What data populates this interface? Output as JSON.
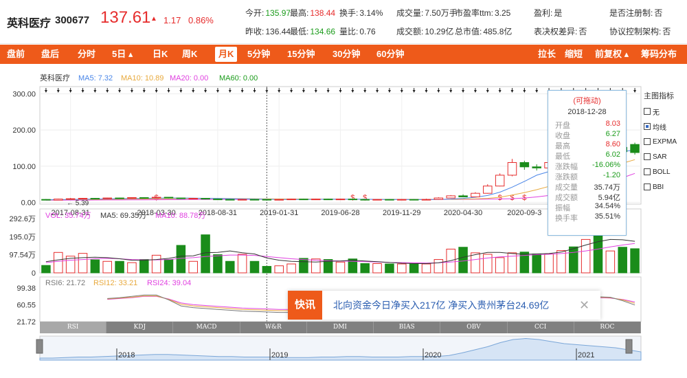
{
  "stock": {
    "name": "英科医疗",
    "code": "300677",
    "price": "137.61",
    "arrow": "▲",
    "change": "1.17",
    "change_pct": "0.86%"
  },
  "quote": [
    {
      "label": "今开:",
      "value": "135.97",
      "cls": "down"
    },
    {
      "label": "最高:",
      "value": "138.44",
      "cls": "up"
    },
    {
      "label": "换手:",
      "value": "3.14%",
      "cls": ""
    },
    {
      "label": "成交量:",
      "value": "7.50万手",
      "cls": ""
    },
    {
      "label": "市盈率ttm:",
      "value": "3.25",
      "cls": ""
    },
    {
      "label": "盈利:",
      "value": "是",
      "cls": ""
    },
    {
      "label": "是否注册制:",
      "value": "否",
      "cls": ""
    },
    {
      "label": "昨收:",
      "value": "136.44",
      "cls": ""
    },
    {
      "label": "最低:",
      "value": "134.66",
      "cls": "down"
    },
    {
      "label": "量比:",
      "value": "0.76",
      "cls": ""
    },
    {
      "label": "成交额:",
      "value": "10.29亿",
      "cls": ""
    },
    {
      "label": "总市值:",
      "value": "485.8亿",
      "cls": ""
    },
    {
      "label": "表决权差异:",
      "value": "否",
      "cls": ""
    },
    {
      "label": "协议控制架构:",
      "value": "否",
      "cls": ""
    }
  ],
  "toolbar": {
    "left": [
      "盘前",
      "盘后",
      "分时",
      "5日 ▴",
      "日K",
      "周K",
      "月K",
      "5分钟",
      "15分钟",
      "30分钟",
      "60分钟"
    ],
    "active": "月K",
    "right": [
      "拉长",
      "缩短",
      "前复权 ▴",
      "筹码分布"
    ]
  },
  "ma_legend": {
    "name": "英科医疗",
    "items": [
      {
        "label": "MA5: 7.32",
        "color": "#4a86e8"
      },
      {
        "label": "MA10: 10.89",
        "color": "#e8a93c"
      },
      {
        "label": "MA20: 0.00",
        "color": "#e040e0"
      },
      {
        "label": "MA60: 0.00",
        "color": "#1a9b1a"
      }
    ]
  },
  "vol_legend": [
    {
      "label": "VOL: 35.74万",
      "color": "#e040e0"
    },
    {
      "label": "MA5: 69.35万",
      "color": "#333333"
    },
    {
      "label": "MA10: 88.78万",
      "color": "#e040e0"
    }
  ],
  "rsi_legend": [
    {
      "label": "RSI6: 21.72",
      "color": "#777777"
    },
    {
      "label": "RSI12: 33.21",
      "color": "#e8a93c"
    },
    {
      "label": "RSI24: 39.04",
      "color": "#e040e0"
    }
  ],
  "low_marker": "5.39",
  "side_panel": {
    "title": "主图指标",
    "items": [
      {
        "label": "无",
        "checked": false
      },
      {
        "label": "均线",
        "checked": true
      },
      {
        "label": "EXPMA",
        "checked": false
      },
      {
        "label": "SAR",
        "checked": false
      },
      {
        "label": "BOLL",
        "checked": false
      },
      {
        "label": "BBI",
        "checked": false
      }
    ]
  },
  "tooltip": {
    "title": "(可拖动)",
    "date": "2018-12-28",
    "rows": [
      {
        "k": "开盘",
        "v": "8.03",
        "cls": "up"
      },
      {
        "k": "收盘",
        "v": "6.27",
        "cls": "down"
      },
      {
        "k": "最高",
        "v": "8.60",
        "cls": "up"
      },
      {
        "k": "最低",
        "v": "6.02",
        "cls": "down"
      },
      {
        "k": "涨跌幅",
        "v": "-16.06%",
        "cls": "down"
      },
      {
        "k": "涨跌额",
        "v": "-1.20",
        "cls": "down"
      },
      {
        "k": "成交量",
        "v": "35.74万",
        "cls": ""
      },
      {
        "k": "成交额",
        "v": "5.94亿",
        "cls": ""
      },
      {
        "k": "振幅",
        "v": "34.54%",
        "cls": ""
      },
      {
        "k": "换手率",
        "v": "35.51%",
        "cls": ""
      }
    ]
  },
  "news": {
    "badge": "快讯",
    "text": "北向资金今日净买入217亿 净买入贵州茅台24.69亿",
    "close": "✕"
  },
  "indicator_tabs": [
    "RSI",
    "KDJ",
    "MACD",
    "W&R",
    "DMI",
    "BIAS",
    "OBV",
    "CCI",
    "ROC"
  ],
  "indicator_active": "RSI",
  "navigator_years": [
    "2018",
    "2019",
    "2020",
    "2021"
  ],
  "chart_data": {
    "type": "candlestick",
    "price_axis": [
      "300.00",
      "200.00",
      "100.00",
      "0.00"
    ],
    "price_ticks": [
      300,
      200,
      100,
      0
    ],
    "price_range": [
      -5,
      320
    ],
    "date_labels": [
      "2017-08-31",
      "2018-03-30",
      "2018-08-31",
      "2019-01-31",
      "2019-06-28",
      "2019-11-29",
      "2020-04-30",
      "2020-09-3"
    ],
    "date_positions": [
      2,
      9,
      14,
      19,
      24,
      29,
      34,
      39
    ],
    "vol_axis": [
      "292.6万",
      "195.0万",
      "97.54万",
      "0"
    ],
    "vol_ticks": [
      292.6,
      195.0,
      97.54,
      0
    ],
    "vol_max": 300,
    "rsi_axis": [
      "99.38",
      "60.55",
      "21.72"
    ],
    "rsi_ticks": [
      99.38,
      60.55,
      21.72
    ],
    "rsi_range": [
      21.72,
      99.38
    ],
    "candles": [
      {
        "o": 8,
        "c": 6,
        "h": 9,
        "l": 5.4
      },
      {
        "o": 6,
        "c": 9,
        "h": 10,
        "l": 5.5
      },
      {
        "o": 9,
        "c": 10,
        "h": 12,
        "l": 8
      },
      {
        "o": 10,
        "c": 11,
        "h": 12,
        "l": 9
      },
      {
        "o": 11,
        "c": 10,
        "h": 12,
        "l": 9
      },
      {
        "o": 10,
        "c": 12,
        "h": 13,
        "l": 9
      },
      {
        "o": 12,
        "c": 11,
        "h": 13,
        "l": 10
      },
      {
        "o": 11,
        "c": 13,
        "h": 14,
        "l": 10
      },
      {
        "o": 13,
        "c": 12,
        "h": 14,
        "l": 11
      },
      {
        "o": 12,
        "c": 14,
        "h": 15,
        "l": 11
      },
      {
        "o": 14,
        "c": 12,
        "h": 15,
        "l": 11
      },
      {
        "o": 12,
        "c": 10,
        "h": 13,
        "l": 9
      },
      {
        "o": 10,
        "c": 11,
        "h": 12,
        "l": 9
      },
      {
        "o": 11,
        "c": 9,
        "h": 12,
        "l": 8
      },
      {
        "o": 9,
        "c": 8,
        "h": 10,
        "l": 7
      },
      {
        "o": 8,
        "c": 7,
        "h": 9,
        "l": 6
      },
      {
        "o": 7,
        "c": 8,
        "h": 9,
        "l": 6
      },
      {
        "o": 8,
        "c": 7,
        "h": 9,
        "l": 6
      },
      {
        "o": 8.03,
        "c": 6.27,
        "h": 8.6,
        "l": 6.02
      },
      {
        "o": 6,
        "c": 8,
        "h": 9,
        "l": 5.8
      },
      {
        "o": 8,
        "c": 9,
        "h": 10,
        "l": 7
      },
      {
        "o": 9,
        "c": 8,
        "h": 10,
        "l": 7
      },
      {
        "o": 8,
        "c": 9,
        "h": 10,
        "l": 7
      },
      {
        "o": 9,
        "c": 8,
        "h": 10,
        "l": 7
      },
      {
        "o": 8,
        "c": 9,
        "h": 10,
        "l": 7
      },
      {
        "o": 9,
        "c": 8,
        "h": 10,
        "l": 7
      },
      {
        "o": 8,
        "c": 7,
        "h": 9,
        "l": 6
      },
      {
        "o": 7,
        "c": 8,
        "h": 9,
        "l": 6
      },
      {
        "o": 8,
        "c": 7,
        "h": 9,
        "l": 6
      },
      {
        "o": 7,
        "c": 8,
        "h": 9,
        "l": 6
      },
      {
        "o": 8,
        "c": 7,
        "h": 9,
        "l": 6
      },
      {
        "o": 7,
        "c": 8,
        "h": 10,
        "l": 6
      },
      {
        "o": 8,
        "c": 12,
        "h": 14,
        "l": 7
      },
      {
        "o": 12,
        "c": 18,
        "h": 20,
        "l": 11
      },
      {
        "o": 18,
        "c": 15,
        "h": 22,
        "l": 14
      },
      {
        "o": 15,
        "c": 25,
        "h": 28,
        "l": 14
      },
      {
        "o": 25,
        "c": 45,
        "h": 50,
        "l": 24
      },
      {
        "o": 45,
        "c": 75,
        "h": 80,
        "l": 44
      },
      {
        "o": 75,
        "c": 110,
        "h": 120,
        "l": 72
      },
      {
        "o": 110,
        "c": 98,
        "h": 115,
        "l": 90
      },
      {
        "o": 98,
        "c": 95,
        "h": 105,
        "l": 88
      },
      {
        "o": 95,
        "c": 110,
        "h": 118,
        "l": 92
      },
      {
        "o": 120,
        "c": 145,
        "h": 165,
        "l": 115
      },
      {
        "o": 150,
        "c": 145,
        "h": 160,
        "l": 130
      },
      {
        "o": 145,
        "c": 160,
        "h": 175,
        "l": 140
      },
      {
        "o": 160,
        "c": 148,
        "h": 165,
        "l": 140
      },
      {
        "o": 148,
        "c": 152,
        "h": 160,
        "l": 140
      },
      {
        "o": 152,
        "c": 140,
        "h": 158,
        "l": 135
      },
      {
        "o": 160,
        "c": 137.6,
        "h": 165,
        "l": 132
      }
    ],
    "ma5": [
      7,
      7.5,
      8,
      8.5,
      9,
      9.5,
      10,
      10.5,
      11,
      11.5,
      12,
      12,
      11.5,
      11,
      10.5,
      10,
      9.5,
      9,
      8.5,
      8,
      8,
      8,
      8.2,
      8.4,
      8.5,
      8.5,
      8.4,
      8.2,
      8,
      7.8,
      7.6,
      7.5,
      8,
      9,
      11,
      14,
      19,
      28,
      42,
      58,
      75,
      85,
      95,
      104,
      115,
      122,
      132,
      140,
      145
    ],
    "ma10": [
      7,
      7.2,
      7.5,
      7.8,
      8,
      8.3,
      8.6,
      9,
      9.3,
      9.6,
      10,
      10.2,
      10.4,
      10.6,
      10.5,
      10.3,
      10,
      9.8,
      9.5,
      9.2,
      9,
      8.8,
      8.6,
      8.5,
      8.4,
      8.3,
      8.3,
      8.2,
      8.2,
      8.1,
      8,
      8,
      8.1,
      8.3,
      8.6,
      9.5,
      11,
      14,
      20,
      27,
      35,
      44,
      54,
      64,
      74,
      84,
      96,
      108,
      118
    ],
    "ma20": [
      6,
      6.1,
      6.2,
      6.3,
      6.4,
      6.5,
      6.6,
      6.8,
      7,
      7.2,
      7.4,
      7.6,
      7.8,
      8,
      8.1,
      8.2,
      8.3,
      8.3,
      8.4,
      8.4,
      8.4,
      8.4,
      8.4,
      8.4,
      8.4,
      8.3,
      8.3,
      8.2,
      8.2,
      8.1,
      8.1,
      8,
      8,
      8.1,
      8.2,
      8.4,
      8.7,
      9.2,
      10,
      12,
      15,
      19,
      24,
      30,
      38,
      47,
      57,
      68,
      80
    ],
    "volumes": [
      40,
      110,
      90,
      105,
      70,
      62,
      62,
      55,
      72,
      95,
      72,
      148,
      62,
      205,
      98,
      62,
      100,
      62,
      35,
      38,
      48,
      78,
      75,
      72,
      58,
      75,
      50,
      50,
      48,
      48,
      48,
      48,
      72,
      128,
      138,
      108,
      100,
      82,
      108,
      112,
      102,
      102,
      120,
      140,
      180,
      230,
      118,
      138,
      130
    ],
    "vol_ma5": [
      60,
      70,
      78,
      82,
      84,
      82,
      76,
      68,
      68,
      72,
      78,
      90,
      92,
      108,
      110,
      118,
      108,
      102,
      80,
      68,
      62,
      60,
      58,
      62,
      64,
      68,
      64,
      60,
      56,
      52,
      50,
      50,
      54,
      66,
      84,
      98,
      110,
      110,
      104,
      100,
      102,
      104,
      112,
      130,
      150,
      168,
      180,
      178,
      170
    ],
    "vol_ma10": [
      55,
      62,
      68,
      72,
      76,
      78,
      76,
      72,
      70,
      70,
      72,
      78,
      82,
      88,
      92,
      96,
      96,
      94,
      88,
      82,
      76,
      72,
      68,
      66,
      64,
      62,
      60,
      58,
      56,
      55,
      54,
      53,
      54,
      58,
      64,
      72,
      80,
      86,
      90,
      94,
      98,
      100,
      104,
      110,
      118,
      128,
      140,
      150,
      158
    ],
    "rsi6": [
      75,
      77,
      80,
      83,
      83,
      72,
      58,
      54,
      52,
      50,
      48,
      46,
      45,
      44,
      43,
      43,
      43,
      44
    ],
    "rsi12": [
      74,
      76,
      78,
      81,
      81,
      73,
      62,
      58,
      56,
      54,
      52,
      50,
      49,
      48,
      47,
      47,
      47,
      48
    ],
    "rsi24": [
      73,
      75,
      77,
      80,
      80,
      74,
      65,
      61,
      59,
      57,
      55,
      53,
      52,
      51,
      50,
      50,
      50,
      51
    ],
    "rsi6_tail": [
      79,
      78,
      70,
      60
    ],
    "rsi12_tail": [
      78,
      77,
      72,
      64
    ],
    "rsi24_tail": [
      77,
      76,
      73,
      67
    ],
    "navigator_profile": [
      4,
      4,
      5,
      6,
      6,
      7,
      8,
      9,
      10,
      11,
      11,
      10,
      9,
      8,
      7,
      7,
      6,
      6,
      6,
      5,
      5,
      5,
      6,
      6,
      7,
      7,
      6,
      6,
      6,
      7,
      7,
      7,
      9,
      14,
      20,
      26,
      34,
      40,
      42,
      40,
      36,
      32,
      30,
      28,
      26,
      24,
      20,
      16
    ]
  }
}
